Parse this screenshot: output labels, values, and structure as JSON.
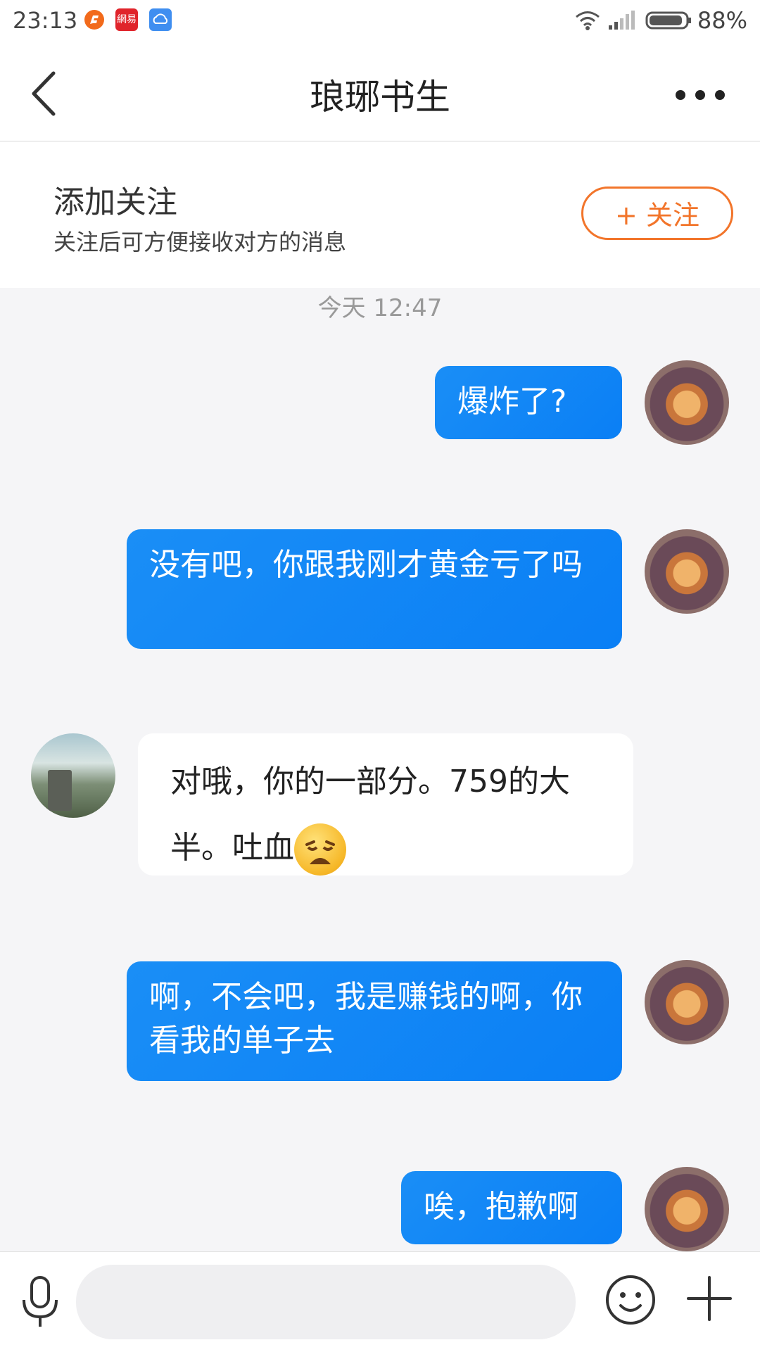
{
  "status_bar": {
    "time": "23:13",
    "battery": "88%",
    "app2_label": "網易"
  },
  "header": {
    "title": "琅琊书生",
    "back_icon": "chevron-left-icon",
    "more_icon": "more-horizontal-icon"
  },
  "follow": {
    "title": "添加关注",
    "subtitle": "关注后可方便接收对方的消息",
    "button_label": "+ 关注"
  },
  "chat": {
    "timestamp": "今天 12:47",
    "messages": [
      {
        "side": "out",
        "text": "爆炸了?"
      },
      {
        "side": "out",
        "text": "没有吧，你跟我刚才黄金亏了吗"
      },
      {
        "side": "in",
        "text": "对哦，你的一部分。759的大半。吐血"
      },
      {
        "side": "out",
        "text": "啊，不会吧，我是赚钱的啊，你看我的单子去"
      },
      {
        "side": "out",
        "text": "唉，抱歉啊"
      }
    ]
  },
  "input_bar": {
    "placeholder": "",
    "icons": [
      "microphone-icon",
      "emoji-icon",
      "plus-icon"
    ]
  },
  "colors": {
    "accent": "#f2752b",
    "bubble_out": "#0a7ff5",
    "background": "#f5f5f7"
  }
}
